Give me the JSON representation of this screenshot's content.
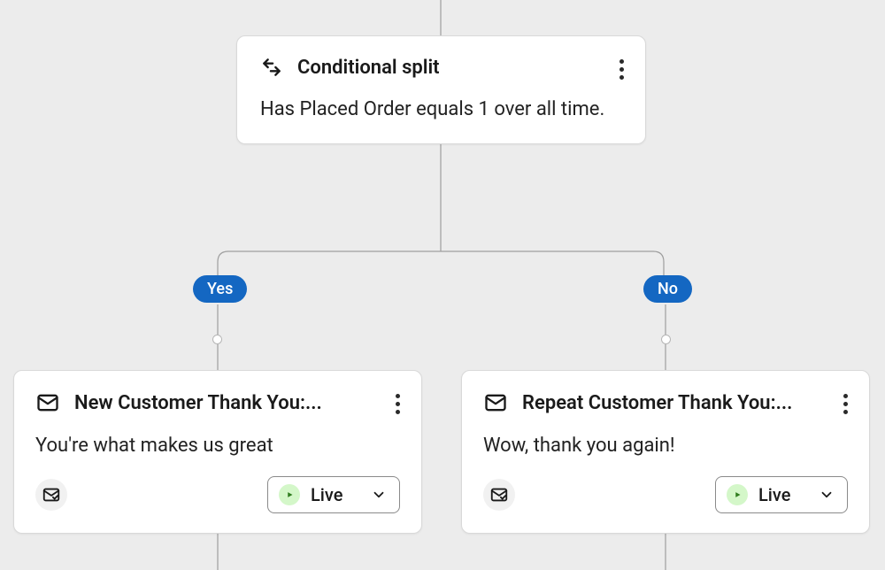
{
  "conditional": {
    "title": "Conditional split",
    "condition": "Has Placed Order equals 1 over all time."
  },
  "branches": {
    "yes_label": "Yes",
    "no_label": "No"
  },
  "left_action": {
    "title": "New Customer Thank You:...",
    "subject": "You're what makes us great",
    "status_label": "Live"
  },
  "right_action": {
    "title": "Repeat Customer Thank You:...",
    "subject": "Wow, thank you again!",
    "status_label": "Live"
  }
}
